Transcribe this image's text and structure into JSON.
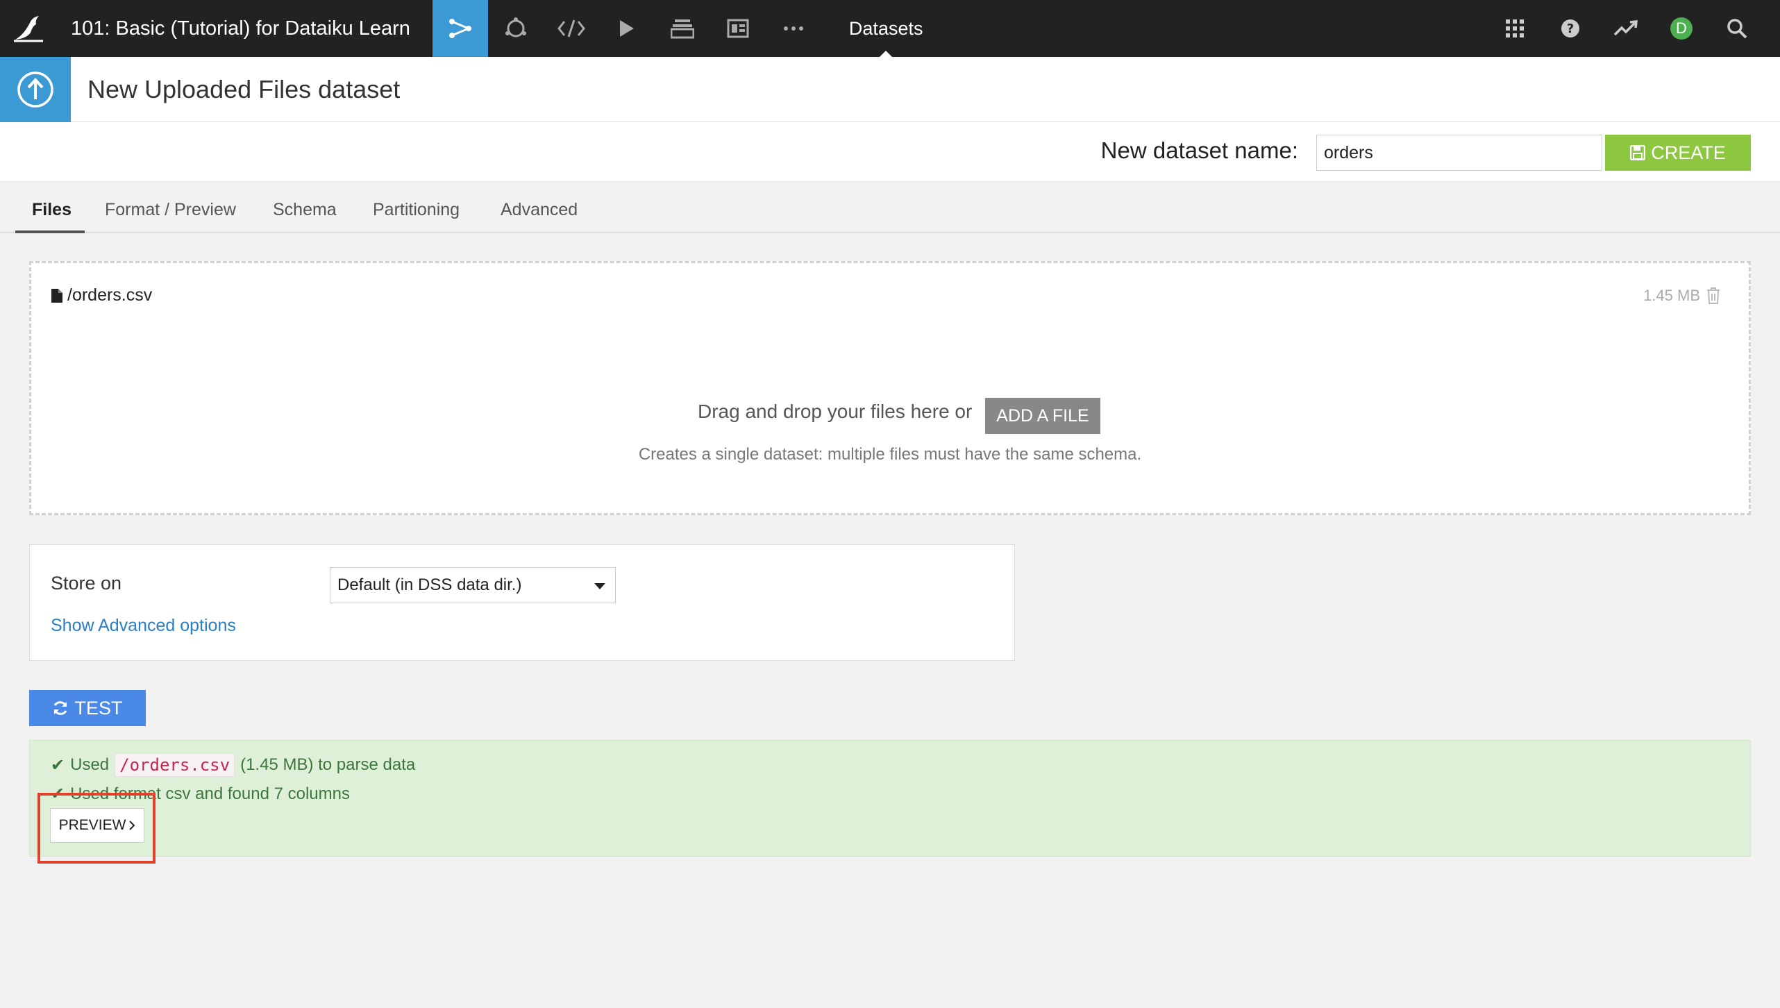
{
  "topbar": {
    "project_title": "101: Basic (Tutorial) for Dataiku Learn",
    "section": "Datasets",
    "nav_icons": [
      "flow-icon",
      "lab-icon",
      "code-icon",
      "run-icon",
      "library-icon",
      "dashboard-icon",
      "more-icon"
    ],
    "right_icons": [
      "apps-grid-icon",
      "help-icon",
      "trend-icon",
      "avatar",
      "search-icon"
    ],
    "avatar_letter": "D",
    "active_color": "#3b99d4"
  },
  "header": {
    "title": "New Uploaded Files dataset"
  },
  "name_bar": {
    "label": "New dataset name:",
    "value": "orders",
    "create_label": "CREATE"
  },
  "tabs": [
    {
      "label": "Files",
      "active": true
    },
    {
      "label": "Format / Preview",
      "active": false
    },
    {
      "label": "Schema",
      "active": false
    },
    {
      "label": "Partitioning",
      "active": false
    },
    {
      "label": "Advanced",
      "active": false
    }
  ],
  "dropzone": {
    "file_name": "/orders.csv",
    "file_size": "1.45 MB",
    "drop_text": "Drag and drop your files here or",
    "add_file_label": "ADD A FILE",
    "sub_text": "Creates a single dataset: multiple files must have the same schema."
  },
  "store": {
    "label": "Store on",
    "selected": "Default (in DSS data dir.)",
    "advanced_link": "Show Advanced options"
  },
  "test": {
    "label": "TEST"
  },
  "result": {
    "line1_prefix": "Used",
    "line1_file": "/orders.csv",
    "line1_suffix": "(1.45 MB) to parse data",
    "line2": "Used format csv and found 7 columns",
    "preview_label": "PREVIEW"
  },
  "colors": {
    "create_green": "#8dc63f",
    "test_blue": "#4b89e8",
    "success_bg": "#dff0d8",
    "highlight_red": "#e0432b"
  }
}
